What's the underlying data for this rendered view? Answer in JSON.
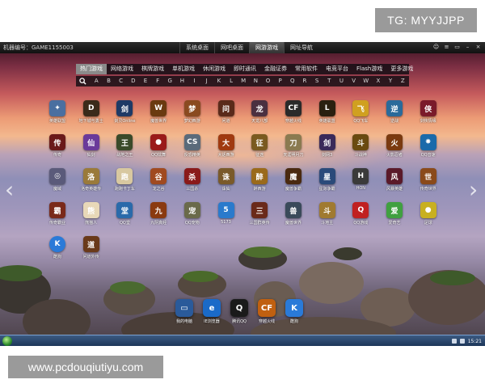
{
  "overlay": {
    "tg": "TG: MYYJJPP",
    "website": "www.pcdouqiutiyu.com"
  },
  "topbar": {
    "machine": "机器编号：GAME1155003",
    "tabs": [
      "系统桌面",
      "网吧桌面",
      "网游游戏",
      "网址导航"
    ],
    "active_tab": 2
  },
  "categories": [
    "热门游戏",
    "网络游戏",
    "棋牌游戏",
    "单机游戏",
    "休闲游戏",
    "即时通讯",
    "金融证券",
    "常用软件",
    "电竞平台",
    "Flash游戏",
    "更多游戏"
  ],
  "letters": [
    "A",
    "B",
    "C",
    "D",
    "E",
    "F",
    "G",
    "H",
    "I",
    "J",
    "K",
    "L",
    "M",
    "N",
    "O",
    "P",
    "Q",
    "R",
    "S",
    "T",
    "U",
    "V",
    "W",
    "X",
    "Y",
    "Z"
  ],
  "arrows": {
    "left": "‹",
    "right": "›"
  },
  "rows": [
    [
      {
        "label": "英雄联盟",
        "glyph": "✦",
        "color": "#4a6fa0"
      },
      {
        "label": "地下城与勇士",
        "glyph": "D",
        "color": "#3a2a1a"
      },
      {
        "label": "剑灵Online",
        "glyph": "剑",
        "color": "#1e3a66"
      },
      {
        "label": "魔兽世界",
        "glyph": "W",
        "color": "#6a3a10"
      },
      {
        "label": "梦幻西游",
        "glyph": "梦",
        "color": "#8a4a20"
      },
      {
        "label": "问道",
        "glyph": "问",
        "color": "#5a2a1a"
      },
      {
        "label": "天龙八部",
        "glyph": "龙",
        "color": "#4a3040"
      },
      {
        "label": "穿越火线",
        "glyph": "CF",
        "color": "#2a2a2a"
      },
      {
        "label": "英雄联盟",
        "glyph": "L",
        "color": "#2a2010"
      },
      {
        "label": "QQ飞车",
        "glyph": "飞",
        "color": "#d0a020"
      },
      {
        "label": "逆战",
        "glyph": "逆",
        "color": "#2a6a9a"
      },
      {
        "label": "剑侠情缘",
        "glyph": "侠",
        "color": "#7a1a2a"
      }
    ],
    [
      {
        "label": "传奇",
        "glyph": "传",
        "color": "#6a1a1a"
      },
      {
        "label": "仙剑",
        "glyph": "仙",
        "color": "#6a3a9a"
      },
      {
        "label": "战地之王",
        "glyph": "王",
        "color": "#3a4a2a"
      },
      {
        "label": "QQ炫舞",
        "glyph": "●",
        "color": "#9a1a1a"
      },
      {
        "label": "反恐精英",
        "glyph": "CS",
        "color": "#5a6a7a"
      },
      {
        "label": "大话西游",
        "glyph": "大",
        "color": "#a03a10"
      },
      {
        "label": "征途",
        "glyph": "征",
        "color": "#7a5a20"
      },
      {
        "label": "天涯明月刀",
        "glyph": "刀",
        "color": "#8a7a50"
      },
      {
        "label": "剑网3",
        "glyph": "剑",
        "color": "#3a2a5a"
      },
      {
        "label": "斗战神",
        "glyph": "斗",
        "color": "#6a4a10"
      },
      {
        "label": "火影忍者",
        "glyph": "火",
        "color": "#7a3a10"
      },
      {
        "label": "QQ音速",
        "glyph": "✸",
        "color": "#1a6aaa"
      }
    ],
    [
      {
        "label": "魔域",
        "glyph": "◎",
        "color": "#5a5a7a"
      },
      {
        "label": "洛奇英雄传",
        "glyph": "洛",
        "color": "#9a7a3a"
      },
      {
        "label": "跑跑卡丁车",
        "glyph": "跑",
        "color": "#d8c8a0"
      },
      {
        "label": "龙之谷",
        "glyph": "谷",
        "color": "#a04a20"
      },
      {
        "label": "三国杀",
        "glyph": "杀",
        "color": "#8a1a1a"
      },
      {
        "label": "诛仙",
        "glyph": "诛",
        "color": "#7a5a2a"
      },
      {
        "label": "醉西游",
        "glyph": "醉",
        "color": "#9a6a1a"
      },
      {
        "label": "魔兽争霸",
        "glyph": "魔",
        "color": "#4a2a10"
      },
      {
        "label": "星际争霸",
        "glyph": "星",
        "color": "#2a4a7a"
      },
      {
        "label": "HON",
        "glyph": "H",
        "color": "#3a3a3a"
      },
      {
        "label": "风暴英雄",
        "glyph": "风",
        "color": "#5a1a2a"
      },
      {
        "label": "传奇世界",
        "glyph": "世",
        "color": "#8a4a1a"
      }
    ],
    [
      {
        "label": "传奇霸业",
        "glyph": "霸",
        "color": "#7a2a1a"
      },
      {
        "label": "熊猫人",
        "glyph": "熊",
        "color": "#e8d8b8"
      },
      {
        "label": "QQ堂",
        "glyph": "堂",
        "color": "#2a6aaa"
      },
      {
        "label": "九阴真经",
        "glyph": "九",
        "color": "#8a3a10"
      },
      {
        "label": "QQ宠物",
        "glyph": "宠",
        "color": "#6a6a4a"
      },
      {
        "label": "5173",
        "glyph": "5",
        "color": "#2a7acc"
      },
      {
        "label": "三国群英传",
        "glyph": "三",
        "color": "#6a2a1a"
      },
      {
        "label": "魔兽世界",
        "glyph": "兽",
        "color": "#3a4a5a"
      },
      {
        "label": "斗地主",
        "glyph": "斗",
        "color": "#a07a30"
      },
      {
        "label": "QQ游戏",
        "glyph": "Q",
        "color": "#c02020"
      },
      {
        "label": "爱奇艺",
        "glyph": "爱",
        "color": "#40a040"
      },
      {
        "label": "足球",
        "glyph": "●",
        "color": "#c8b020"
      }
    ],
    [
      {
        "label": "酷狗",
        "glyph": "K",
        "color": "#2a7ad8",
        "round": true
      },
      {
        "label": "问道外传",
        "glyph": "道",
        "color": "#6a3a1a"
      }
    ]
  ],
  "dock": [
    {
      "label": "我的电脑",
      "glyph": "▭",
      "color": "#2a5a9a"
    },
    {
      "label": "IE浏览器",
      "glyph": "e",
      "color": "#1a6ac8"
    },
    {
      "label": "腾讯QQ",
      "glyph": "Q",
      "color": "#1a1a1a"
    },
    {
      "label": "穿越火线",
      "glyph": "CF",
      "color": "#c06010"
    },
    {
      "label": "酷狗",
      "glyph": "K",
      "color": "#2a7ad8"
    }
  ],
  "taskbar": {
    "clock": "15:21"
  }
}
